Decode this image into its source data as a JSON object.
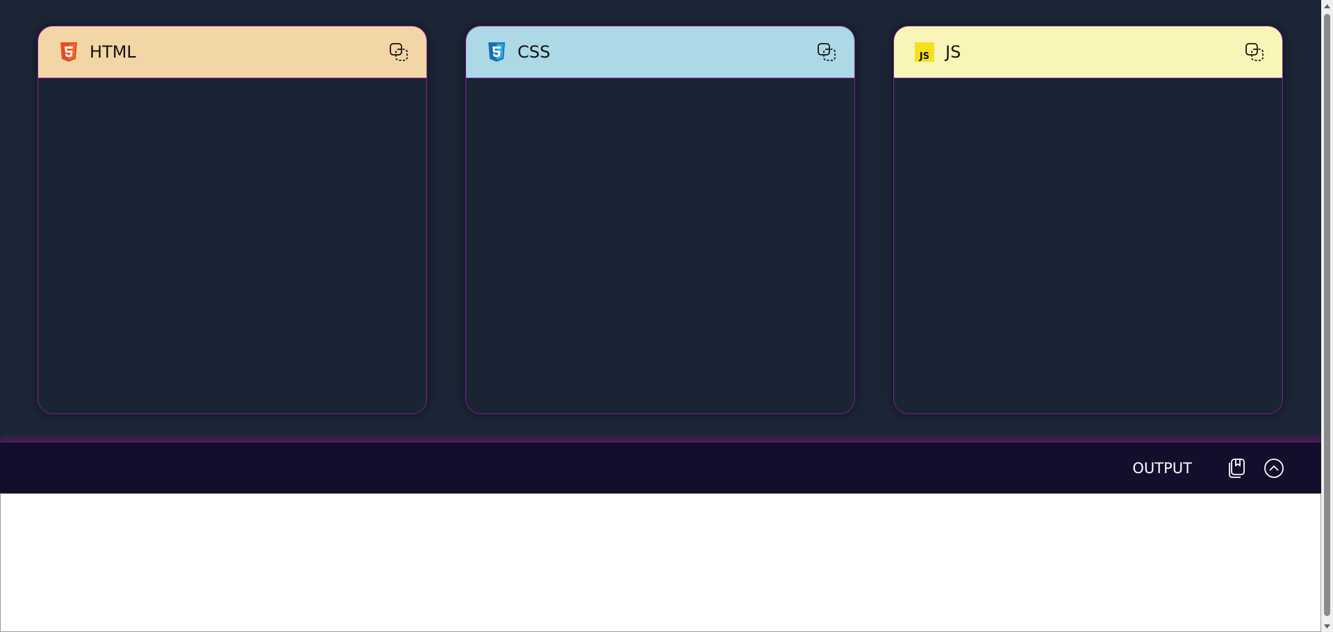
{
  "panels": [
    {
      "label": "HTML",
      "icon": "html5-icon",
      "color": "#f3d6a5",
      "icon_color": "#e44d26"
    },
    {
      "label": "CSS",
      "icon": "css3-icon",
      "color": "#add8e6",
      "icon_color": "#1572b6"
    },
    {
      "label": "JS",
      "icon": "js-icon",
      "color": "#f9f5b8",
      "icon_color": "#f7df1e"
    }
  ],
  "js_badge": "JS",
  "output": {
    "label": "OUTPUT",
    "save_icon": "save-icon",
    "toggle_icon": "chevron-up-circle-icon"
  },
  "colors": {
    "background": "#1b2535",
    "accent_border": "#8a1a9e",
    "output_bar": "#110f2c"
  }
}
